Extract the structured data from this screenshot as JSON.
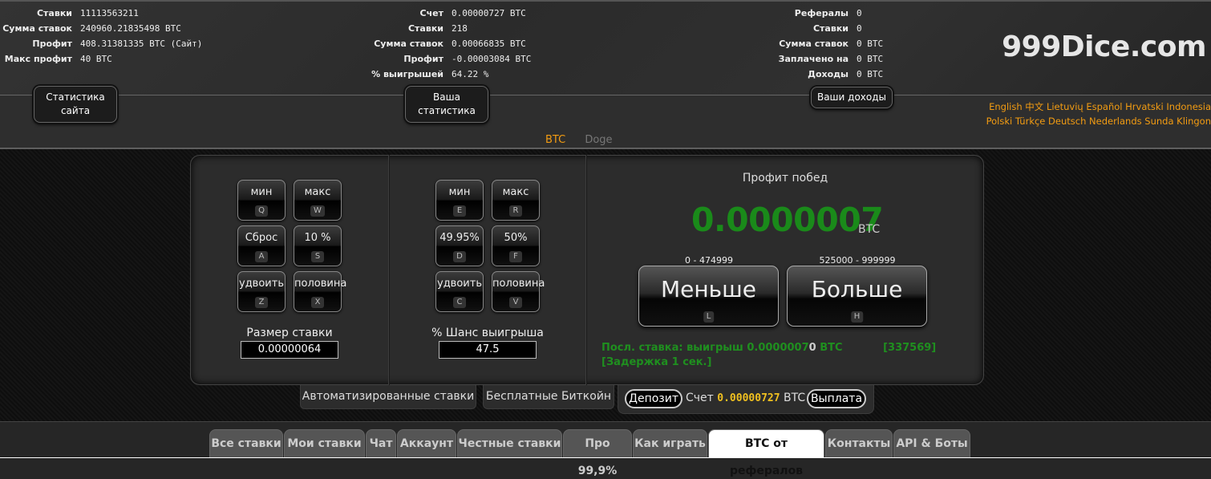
{
  "site_stats": {
    "rows": [
      {
        "label": "Ставки",
        "value": "11113563211"
      },
      {
        "label": "Сумма ставок",
        "value": "240960.21835498 BTC"
      },
      {
        "label": "Профит",
        "value": "408.31381335 BTC (Сайт)"
      },
      {
        "label": "Макс профит",
        "value": "40 BTC"
      }
    ],
    "button": "Статистика сайта"
  },
  "your_stats": {
    "rows": [
      {
        "label": "Счет",
        "value": "0.00000727 BTC"
      },
      {
        "label": "Ставки",
        "value": "218"
      },
      {
        "label": "Сумма ставок",
        "value": "0.00066835 BTC"
      },
      {
        "label": "Профит",
        "value": "-0.00003084 BTC"
      },
      {
        "label": "% выигрышей",
        "value": "64.22 %"
      }
    ],
    "button": "Ваша статистика"
  },
  "referral_stats": {
    "rows": [
      {
        "label": "Рефералы",
        "value": "0"
      },
      {
        "label": "Ставки",
        "value": "0"
      },
      {
        "label": "Сумма ставок",
        "value": "0 BTC"
      },
      {
        "label": "Заплачено на",
        "value": "0 BTC"
      },
      {
        "label": "Доходы",
        "value": "0 BTC"
      }
    ],
    "button": "Ваши доходы"
  },
  "logo": "999Dice.com",
  "languages": {
    "line1": "English 中文 Lietuvių Español Hrvatski Indonesia",
    "line2": "Polski Türkçe Deutsch Nederlands Sunda Klingon"
  },
  "currency_tabs": {
    "active": "BTC",
    "inactive": "Doge"
  },
  "bet_size": {
    "buttons": [
      {
        "label": "мин",
        "key": "Q"
      },
      {
        "label": "макс",
        "key": "W"
      },
      {
        "label": "Сброс",
        "key": "A"
      },
      {
        "label": "10 %",
        "key": "S"
      },
      {
        "label": "удвоить",
        "key": "Z"
      },
      {
        "label": "половина",
        "key": "X"
      }
    ],
    "label": "Размер ставки",
    "value": "0.00000064"
  },
  "win_chance": {
    "buttons": [
      {
        "label": "мин",
        "key": "E"
      },
      {
        "label": "макс",
        "key": "R"
      },
      {
        "label": "49.95%",
        "key": "D"
      },
      {
        "label": "50%",
        "key": "F"
      },
      {
        "label": "удвоить",
        "key": "C"
      },
      {
        "label": "половина",
        "key": "V"
      }
    ],
    "label": "% Шанс выигрыша",
    "value": "47.5"
  },
  "profit": {
    "title": "Профит побед",
    "amount": "0.0000007",
    "unit": "BTC"
  },
  "roll": {
    "low": {
      "range": "0 - 474999",
      "label": "Меньше",
      "key": "L"
    },
    "high": {
      "range": "525000 - 999999",
      "label": "Больше",
      "key": "H"
    }
  },
  "last_bet": {
    "prefix": "Посл. ставка: выигрыш 0.0000007",
    "zero": "0",
    "suffix": " BTC",
    "details": "[337569] [Задержка 1 сек.]"
  },
  "subtabs": {
    "auto": "Автоматизированные ставки",
    "free": "Бесплатные Биткойн"
  },
  "wallet": {
    "deposit": "Депозит",
    "account_label": "Счет",
    "amount": "0.00000727",
    "unit": "BTC",
    "withdraw": "Выплата"
  },
  "bottom_tabs": [
    "Все ставки",
    "Мои ставки",
    "Чат",
    "Аккаунт",
    "Честные ставки",
    "Про 99,9%",
    "Как играть",
    "BTC от рефералов",
    "Контакты",
    "API & Боты"
  ],
  "active_bottom_tab": "BTC от рефералов",
  "colors": {
    "accent": "#f39c12",
    "win": "#1a8a1a",
    "balance": "#f0c020"
  }
}
